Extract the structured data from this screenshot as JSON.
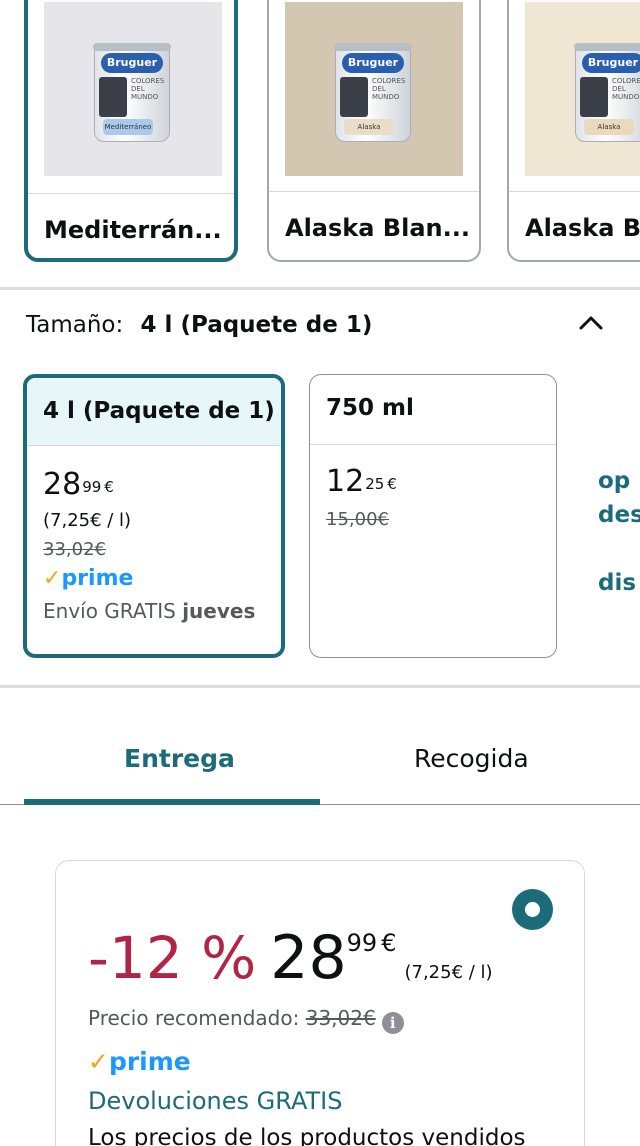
{
  "colors": {
    "accent": "#1b6b7a",
    "discount": "#b12445",
    "prime_blue": "#1a98ff",
    "prime_check": "#f7a21b"
  },
  "swatches": [
    {
      "name": "Mediterrán...",
      "selected": true,
      "bg": "#e6e6ea",
      "brand": "Bruguer",
      "line": "COLORES DEL MUNDO",
      "label": "Mediterráneo",
      "label_bg": "#a9c9ee"
    },
    {
      "name": "Alaska Blan...",
      "selected": false,
      "bg": "#d3c7b1",
      "brand": "Bruguer",
      "line": "COLORES DEL MUNDO",
      "label": "Alaska",
      "label_bg": "#e9ddc8"
    },
    {
      "name": "Alaska Bl",
      "selected": false,
      "bg": "#efe6d4",
      "brand": "Bruguer",
      "line": "COLORES DEL MUNDO",
      "label": "Alaska",
      "label_bg": "#ead9bd"
    }
  ],
  "size": {
    "label": "Tamaño:",
    "value": "4 l (Paquete de 1)",
    "collapse_icon": "chevron-up-icon"
  },
  "size_options": [
    {
      "title": "4 l (Paquete de 1)",
      "selected": true,
      "price_whole": "28",
      "price_fraction": "99",
      "currency": "€",
      "unit_price": "(7,25€ / l)",
      "old_price": "33,02€",
      "prime": "prime",
      "shipping_prefix": "Envío GRATIS",
      "shipping_day": "jueves"
    },
    {
      "title": "750 ml",
      "selected": false,
      "price_whole": "12",
      "price_fraction": "25",
      "currency": "€",
      "old_price": "15,00€"
    }
  ],
  "side_options_lines": [
    "op",
    "des",
    "",
    "dis"
  ],
  "tabs": [
    {
      "label": "Entrega",
      "active": true
    },
    {
      "label": "Recogida",
      "active": false
    }
  ],
  "offer": {
    "discount": "-12 %",
    "price_whole": "28",
    "price_fraction": "99",
    "currency": "€",
    "unit_price": "(7,25€ / l)",
    "rrp_label": "Precio recomendado:",
    "rrp_value": "33,02€",
    "info_icon": "info-icon",
    "prime": "prime",
    "returns": "Devoluciones GRATIS",
    "note": "Los precios de los productos vendidos"
  }
}
